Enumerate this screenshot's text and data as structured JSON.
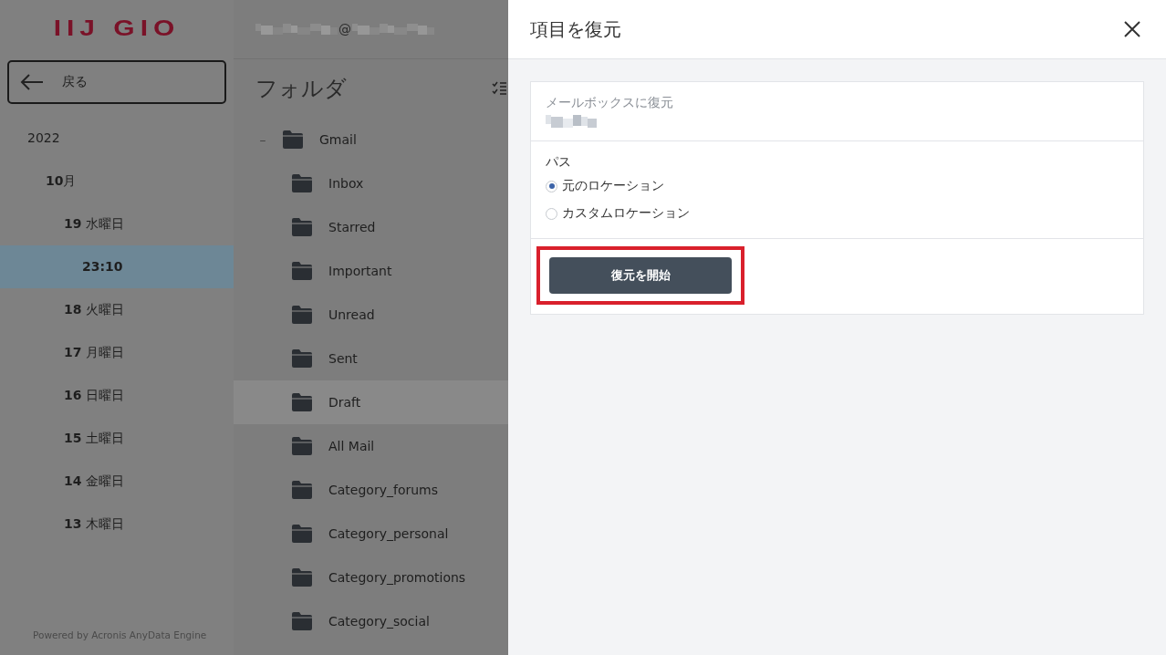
{
  "sidebar": {
    "logo": "IIJ GIO",
    "back_button": "戻る",
    "dates": [
      {
        "label": "2022",
        "children": [
          {
            "label": "**10**月",
            "children": [
              {
                "label": "**19** 水曜日",
                "children": [
                  {
                    "label": "23:10",
                    "selected": true
                  }
                ]
              },
              {
                "label": "**18** 火曜日",
                "selected": false
              },
              {
                "label": "**17** 月曜日",
                "selected": false
              },
              {
                "label": "**16** 日曜日",
                "selected": false
              },
              {
                "label": "**15** 土曜日",
                "selected": false
              },
              {
                "label": "**14** 金曜日",
                "selected": false
              },
              {
                "label": "**13** 木曜日",
                "selected": false
              }
            ]
          }
        ]
      }
    ],
    "footer": "Powered by Acronis AnyData Engine"
  },
  "account": {
    "at_sign": "@"
  },
  "folders": {
    "title": "フォルダ",
    "tree": [
      {
        "label": "Gmail",
        "expanded": true,
        "toggle": "–",
        "selected": false,
        "children": [
          {
            "label": "Inbox",
            "selected": false
          },
          {
            "label": "Starred",
            "selected": false
          },
          {
            "label": "Important",
            "selected": false
          },
          {
            "label": "Unread",
            "selected": false
          },
          {
            "label": "Sent",
            "selected": false
          },
          {
            "label": "Draft",
            "selected": true
          },
          {
            "label": "All Mail",
            "selected": false
          },
          {
            "label": "Category_forums",
            "selected": false
          },
          {
            "label": "Category_personal",
            "selected": false
          },
          {
            "label": "Category_promotions",
            "selected": false
          },
          {
            "label": "Category_social",
            "selected": false
          }
        ]
      }
    ]
  },
  "dialog": {
    "title": "項目を復元",
    "target": {
      "label": "メールボックスに復元"
    },
    "path": {
      "label": "パス",
      "options": [
        {
          "label": "元のロケーション",
          "selected": true
        },
        {
          "label": "カスタムロケーション",
          "selected": false
        }
      ]
    },
    "start_button": {
      "label": "復元を開始",
      "highlighted": true
    }
  }
}
